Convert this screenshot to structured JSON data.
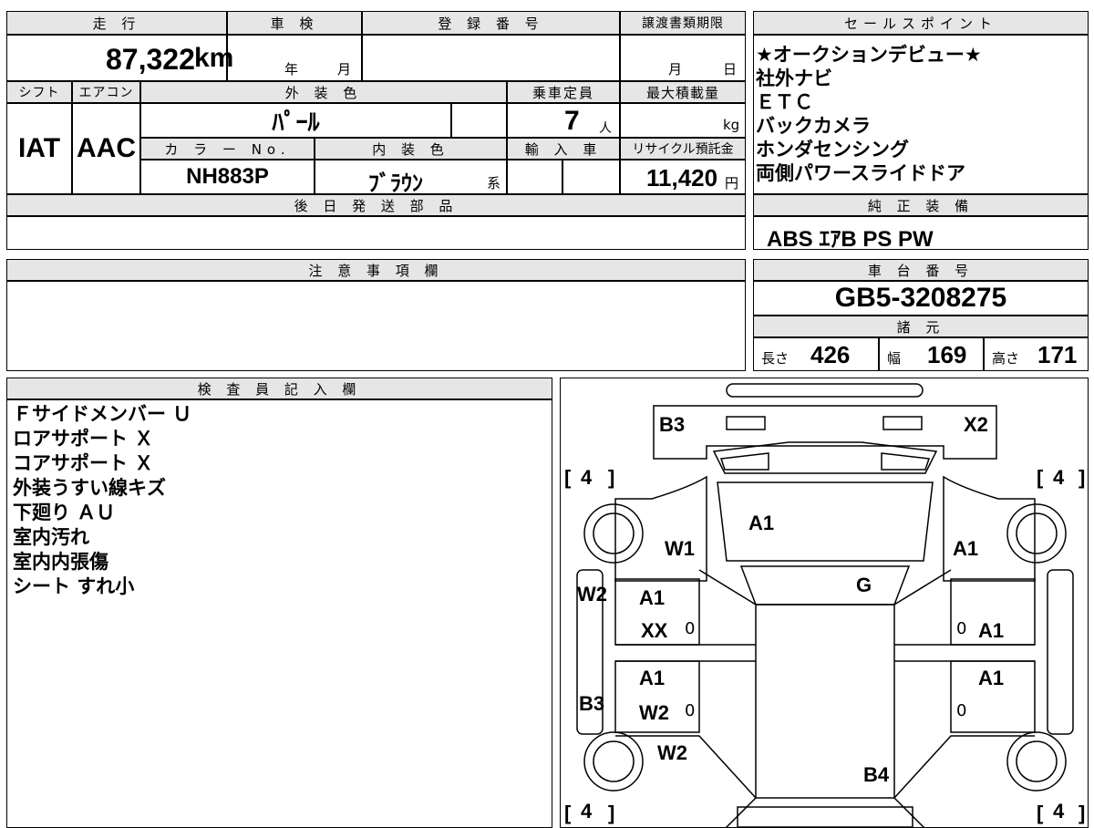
{
  "summary": {
    "mileage_header": "走 行",
    "mileage_value": "87,322",
    "mileage_unit": "km",
    "inspection_header": "車 検",
    "inspection_year": "年",
    "inspection_month": "月",
    "registration_header": "登 録 番 号",
    "transfer_deadline_header": "譲渡書類期限",
    "transfer_month": "月",
    "transfer_day": "日"
  },
  "vehicle": {
    "shift_header": "シフト",
    "shift_value": "IAT",
    "ac_header": "エアコン",
    "ac_value": "AAC",
    "exterior_color_header": "外 装 色",
    "exterior_color_value": "ﾊﾟｰﾙ",
    "capacity_header": "乗車定員",
    "capacity_value": "7",
    "capacity_unit": "人",
    "max_load_header": "最大積載量",
    "max_load_unit": "kg",
    "color_no_header": "カ ラ ー No.",
    "color_no_value": "NH883P",
    "interior_color_header": "内 装 色",
    "interior_color_value": "ﾌﾞﾗｳﾝ",
    "interior_color_suffix": "系",
    "import_header": "輸 入 車",
    "recycle_header": "リサイクル預託金",
    "recycle_value": "11,420",
    "recycle_unit": "円",
    "later_parts_header": "後 日 発 送 部 品"
  },
  "sales_points": {
    "header": "セールスポイント",
    "items": [
      "★オークションデビュー★",
      "社外ナビ",
      "ＥＴＣ",
      "バックカメラ",
      "ホンダセンシング",
      "両側パワースライドドア"
    ]
  },
  "standard_equipment": {
    "header": "純 正 装 備",
    "value": "ABS ｴｱB PS PW"
  },
  "notes": {
    "header": "注 意 事 項 欄"
  },
  "chassis": {
    "header": "車 台 番 号",
    "value": "GB5-3208275"
  },
  "specs": {
    "header": "諸 元",
    "length_label": "長さ",
    "length_value": "426",
    "width_label": "幅",
    "width_value": "169",
    "height_label": "高さ",
    "height_value": "171"
  },
  "inspector": {
    "header": "検 査 員 記 入 欄",
    "lines": [
      "Ｆサイドメンバー Ｕ",
      "ロアサポート Ｘ",
      "コアサポート Ｘ",
      "外装うすい線キズ",
      "下廻り ＡＵ",
      "室内汚れ",
      "室内内張傷",
      "シート すれ小"
    ]
  },
  "diagram": {
    "marks": {
      "front_left": "B3",
      "front_right": "X2",
      "hood": "A1",
      "fender_left": "W1",
      "fender_right": "A1",
      "roof": "G",
      "pillar_left": "W2",
      "door_fl_1": "A1",
      "door_fl_2": "XX",
      "door_rl_1": "A1",
      "door_rl_2": "W2",
      "rocker_left": "B3",
      "quarter_left": "W2",
      "door_fr": "A1",
      "door_rr": "A1",
      "rear": "B4"
    },
    "tire_front_left": "4",
    "tire_front_right": "4",
    "tire_rear_left": "4",
    "tire_rear_right": "4",
    "zero_mark": "0"
  }
}
